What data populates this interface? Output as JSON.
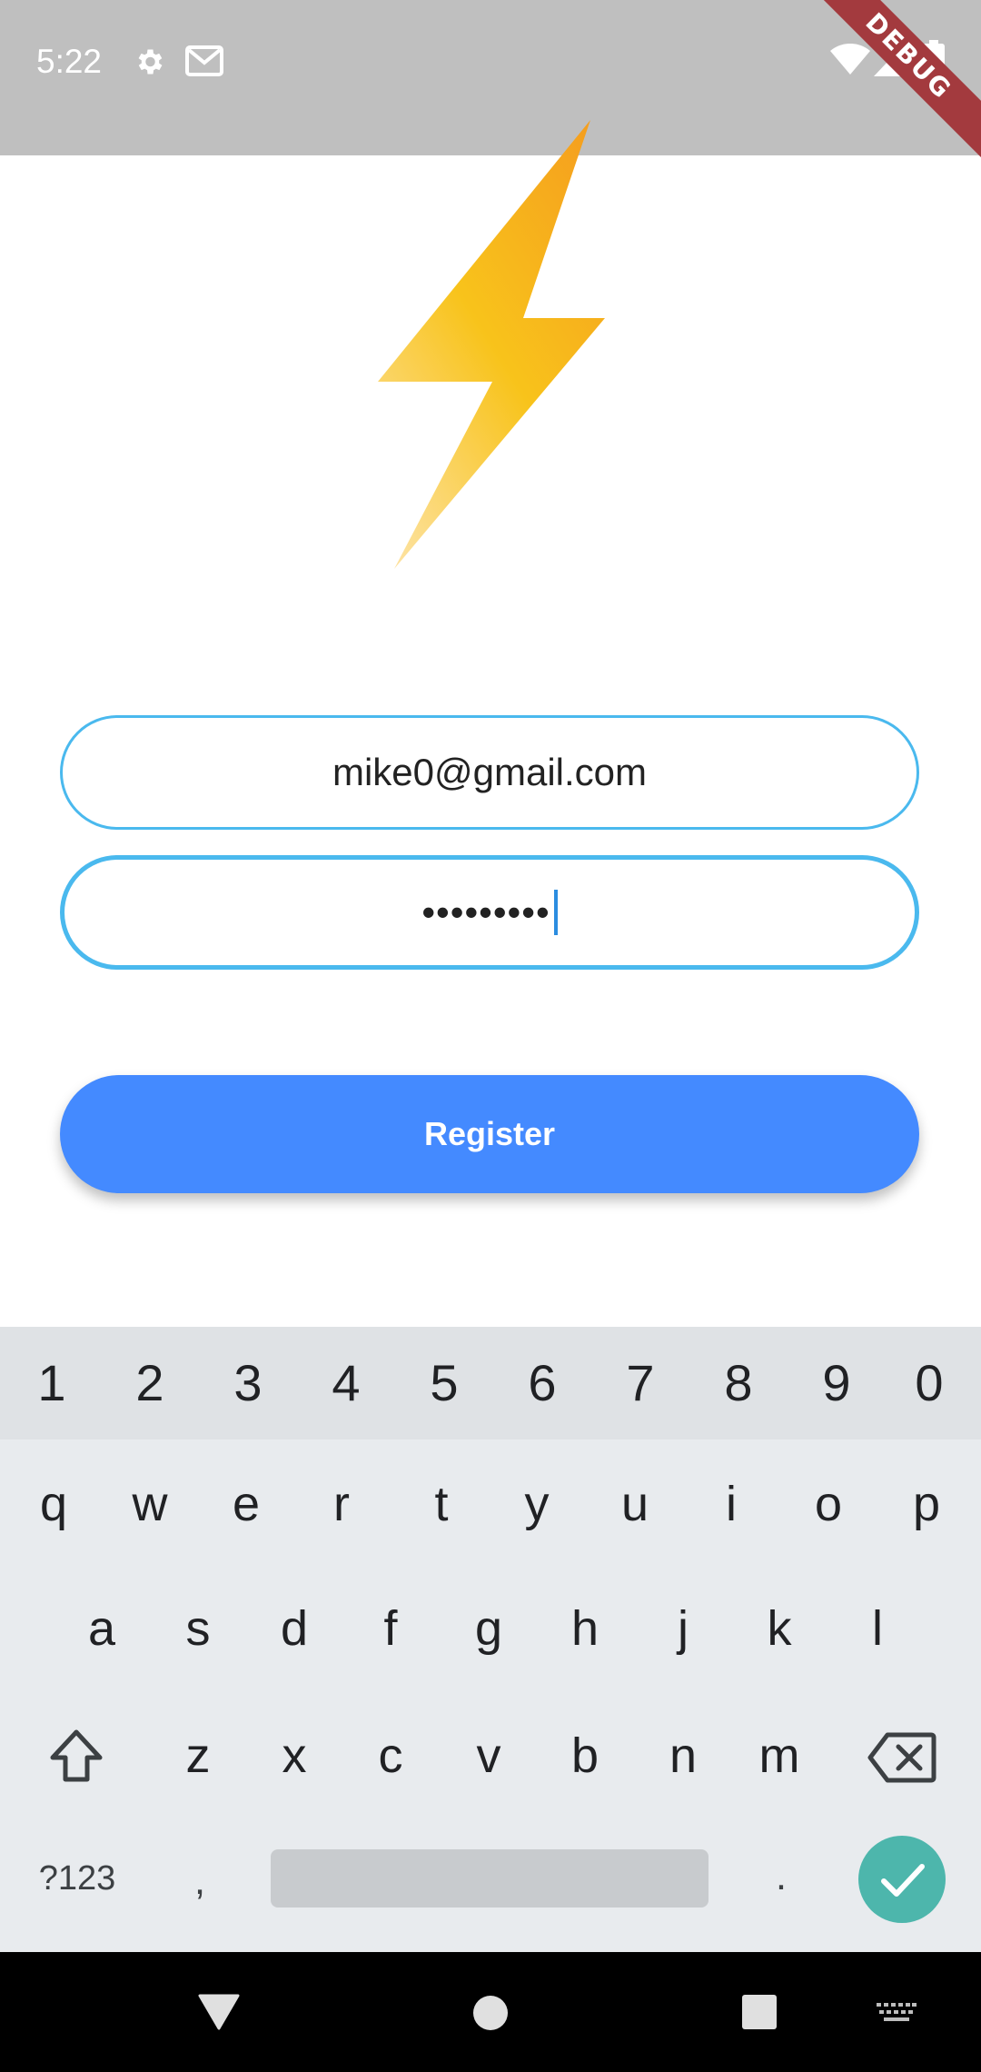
{
  "status_bar": {
    "time": "5:22",
    "debug_label": "DEBUG",
    "icons": [
      "settings-icon",
      "gmail-icon",
      "wifi-icon",
      "signal-icon",
      "battery-icon"
    ]
  },
  "logo": {
    "icon": "lightning-bolt-icon",
    "colors": [
      "#f9a825",
      "#fbc02d",
      "#fdd77a"
    ]
  },
  "form": {
    "email_value": "mike0@gmail.com",
    "password_value": "•••••••••",
    "register_label": "Register"
  },
  "colors": {
    "field_border": "#4ab9ee",
    "button": "#448aff",
    "enter_key": "#4db6ac"
  },
  "keyboard": {
    "numbers": [
      "1",
      "2",
      "3",
      "4",
      "5",
      "6",
      "7",
      "8",
      "9",
      "0"
    ],
    "row1": [
      "q",
      "w",
      "e",
      "r",
      "t",
      "y",
      "u",
      "i",
      "o",
      "p"
    ],
    "row2": [
      "a",
      "s",
      "d",
      "f",
      "g",
      "h",
      "j",
      "k",
      "l"
    ],
    "row3": [
      "z",
      "x",
      "c",
      "v",
      "b",
      "n",
      "m"
    ],
    "symbols_label": "?123",
    "comma": ",",
    "period": ".",
    "icons": [
      "shift-icon",
      "backspace-icon",
      "check-icon"
    ]
  },
  "nav_bar": {
    "icons": [
      "back-icon",
      "home-icon",
      "recents-icon",
      "keyboard-switch-icon"
    ]
  }
}
